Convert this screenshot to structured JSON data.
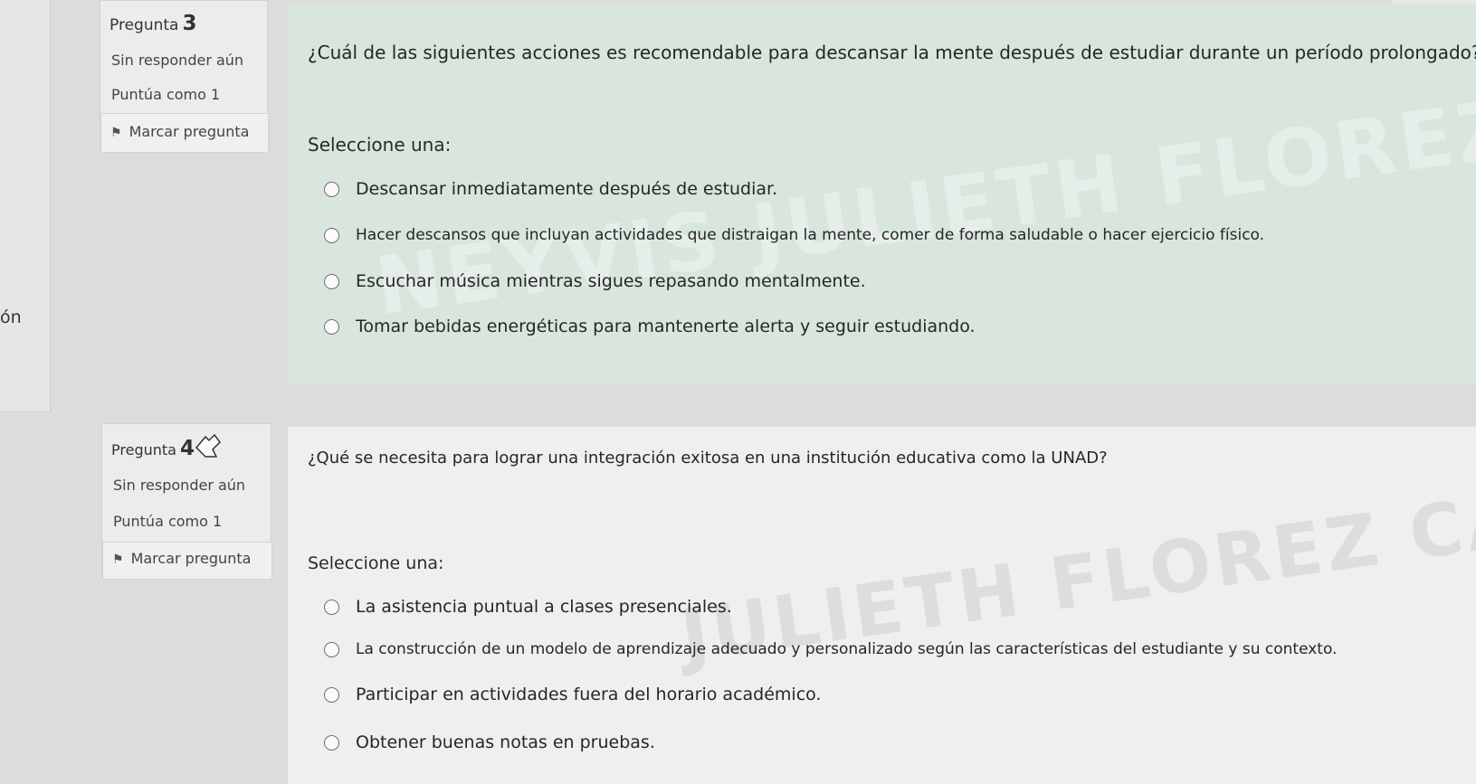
{
  "partial_left_text": "ón",
  "corner_text": "NEYVIS JULIE",
  "question1": {
    "label": "Pregunta",
    "number": "3",
    "status": "Sin responder aún",
    "points": "Puntúa como 1",
    "flag_label": "Marcar pregunta",
    "text": "¿Cuál de las siguientes acciones es recomendable para descansar la mente después de estudiar durante un período prolongado?",
    "prompt": "Seleccione una:",
    "options": [
      "Descansar inmediatamente después de estudiar.",
      "Hacer descansos que incluyan actividades que distraigan la mente, comer de forma saludable o hacer ejercicio físico.",
      "Escuchar música mientras sigues repasando mentalmente.",
      "Tomar bebidas energéticas para mantenerte alerta y seguir estudiando."
    ],
    "watermark": "NEYVIS JULIETH FLOREZ CAMA"
  },
  "question2": {
    "label": "Pregunta",
    "number": "4",
    "status": "Sin responder aún",
    "points": "Puntúa como 1",
    "flag_label": "Marcar pregunta",
    "text": "¿Qué se necesita para lograr una integración exitosa en una institución educativa como la UNAD?",
    "prompt": "Seleccione una:",
    "options": [
      "La asistencia puntual a clases presenciales.",
      "La construcción de un modelo de aprendizaje adecuado y personalizado según las características del estudiante y su contexto.",
      "Participar en actividades fuera del horario académico.",
      "Obtener buenas notas en pruebas."
    ],
    "watermark": "JULIETH FLOREZ CAMA"
  },
  "icons": {
    "flag": "flag-icon",
    "cursor": "hand-cursor-icon"
  }
}
